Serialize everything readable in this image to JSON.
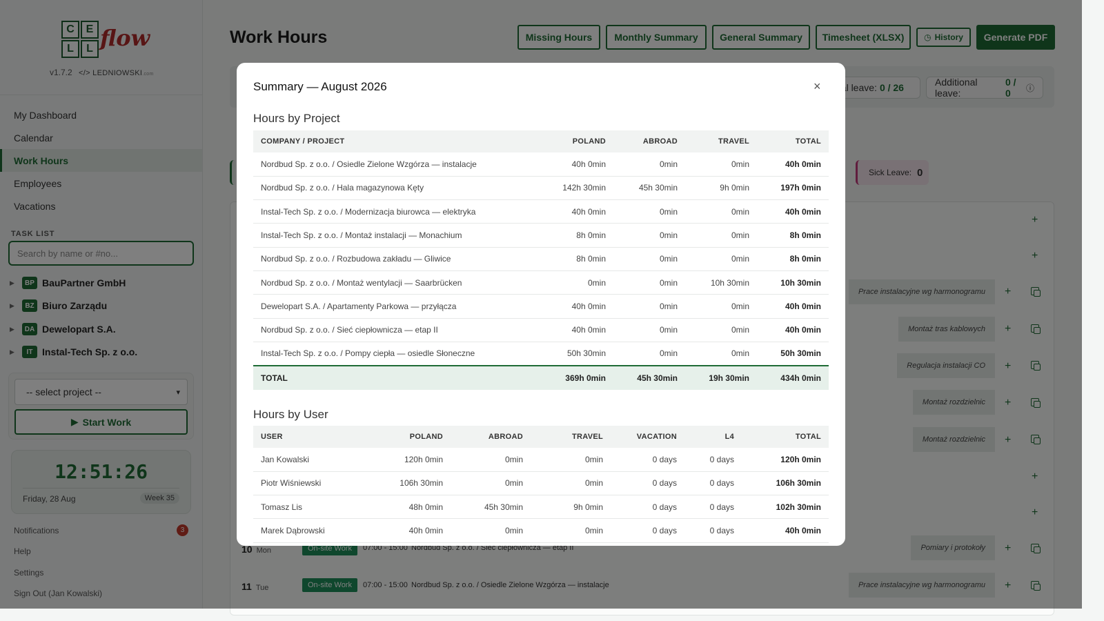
{
  "app": {
    "logo_letters": [
      "C",
      "E",
      "L",
      "L"
    ],
    "logo_word": "flow",
    "version": "v1.7.2",
    "brand": "</> LEDNIOWSKI",
    "brand_suffix": ".com"
  },
  "sidebar": {
    "nav": [
      {
        "label": "My Dashboard"
      },
      {
        "label": "Calendar"
      },
      {
        "label": "Work Hours",
        "active": true
      },
      {
        "label": "Employees"
      },
      {
        "label": "Vacations"
      }
    ],
    "task_list_label": "TASK LIST",
    "search_placeholder": "Search by name or #no...",
    "companies": [
      {
        "badge": "BP",
        "name": "BauPartner GmbH"
      },
      {
        "badge": "BZ",
        "name": "Biuro Zarządu"
      },
      {
        "badge": "DA",
        "name": "Dewelopart S.A."
      },
      {
        "badge": "IT",
        "name": "Instal-Tech Sp. z o.o."
      }
    ],
    "project_select": "-- select project --",
    "start_button": "Start Work",
    "clock": {
      "time": "12:51:26",
      "date": "Friday, 28 Aug",
      "week": "Week 35"
    },
    "footer": {
      "notifications": "Notifications",
      "notifications_count": "3",
      "help": "Help",
      "settings": "Settings",
      "sign_out": "Sign Out (Jan Kowalski)"
    }
  },
  "main": {
    "title": "Work Hours",
    "buttons": {
      "missing": "Missing Hours",
      "monthly": "Monthly Summary",
      "general": "General Summary",
      "timesheet": "Timesheet (XLSX)",
      "history": "History",
      "pdf": "Generate PDF"
    },
    "annual_leave_label": "ual leave:",
    "annual_leave_value": "0 / 26",
    "additional_leave_label": "Additional leave:",
    "additional_leave_value": "0 / 0",
    "sick_leave_label": "Sick Leave:",
    "sick_leave_value": "0",
    "row_descriptions": [
      "Prace instalacyjne wg harmonogramu",
      "Montaż tras kablowych",
      "Regulacja instalacji CO",
      "Montaż rozdzielnic",
      "Montaż rozdzielnic",
      "Pomiary i protokoły",
      "Prace instalacyjne wg harmonogramu"
    ],
    "rows_bottom": [
      {
        "day": "10",
        "dow": "Mon",
        "type": "On-site Work",
        "time": "07:00 - 15:00",
        "project": "Nordbud Sp. z o.o. / Sieć ciepłownicza — etap II"
      },
      {
        "day": "11",
        "dow": "Tue",
        "type": "On-site Work",
        "time": "07:00 - 15:00",
        "project": "Nordbud Sp. z o.o. / Osiedle Zielone Wzgórza — instalacje"
      }
    ]
  },
  "modal": {
    "title": "Summary — August 2026",
    "close": "×",
    "projects_title": "Hours by Project",
    "projects_headers": [
      "COMPANY / PROJECT",
      "POLAND",
      "ABROAD",
      "TRAVEL",
      "TOTAL"
    ],
    "projects_rows": [
      [
        "Nordbud Sp. z o.o. / Osiedle Zielone Wzgórza — instalacje",
        "40h 0min",
        "0min",
        "0min",
        "40h 0min"
      ],
      [
        "Nordbud Sp. z o.o. / Hala magazynowa Kęty",
        "142h 30min",
        "45h 30min",
        "9h 0min",
        "197h 0min"
      ],
      [
        "Instal-Tech Sp. z o.o. / Modernizacja biurowca — elektryka",
        "40h 0min",
        "0min",
        "0min",
        "40h 0min"
      ],
      [
        "Instal-Tech Sp. z o.o. / Montaż instalacji — Monachium",
        "8h 0min",
        "0min",
        "0min",
        "8h 0min"
      ],
      [
        "Nordbud Sp. z o.o. / Rozbudowa zakładu — Gliwice",
        "8h 0min",
        "0min",
        "0min",
        "8h 0min"
      ],
      [
        "Nordbud Sp. z o.o. / Montaż wentylacji — Saarbrücken",
        "0min",
        "0min",
        "10h 30min",
        "10h 30min"
      ],
      [
        "Dewelopart S.A. / Apartamenty Parkowa — przyłącza",
        "40h 0min",
        "0min",
        "0min",
        "40h 0min"
      ],
      [
        "Nordbud Sp. z o.o. / Sieć ciepłownicza — etap II",
        "40h 0min",
        "0min",
        "0min",
        "40h 0min"
      ],
      [
        "Instal-Tech Sp. z o.o. / Pompy ciepła — osiedle Słoneczne",
        "50h 30min",
        "0min",
        "0min",
        "50h 30min"
      ]
    ],
    "projects_total": [
      "TOTAL",
      "369h 0min",
      "45h 30min",
      "19h 30min",
      "434h 0min"
    ],
    "users_title": "Hours by User",
    "users_headers": [
      "USER",
      "POLAND",
      "ABROAD",
      "TRAVEL",
      "VACATION",
      "L4",
      "TOTAL"
    ],
    "users_rows": [
      [
        "Jan Kowalski",
        "120h 0min",
        "0min",
        "0min",
        "0 days",
        "0 days",
        "120h 0min"
      ],
      [
        "Piotr Wiśniewski",
        "106h 30min",
        "0min",
        "0min",
        "0 days",
        "0 days",
        "106h 30min"
      ],
      [
        "Tomasz Lis",
        "48h 0min",
        "45h 30min",
        "9h 0min",
        "0 days",
        "0 days",
        "102h 30min"
      ],
      [
        "Marek Dąbrowski",
        "40h 0min",
        "0min",
        "0min",
        "0 days",
        "0 days",
        "40h 0min"
      ]
    ]
  }
}
